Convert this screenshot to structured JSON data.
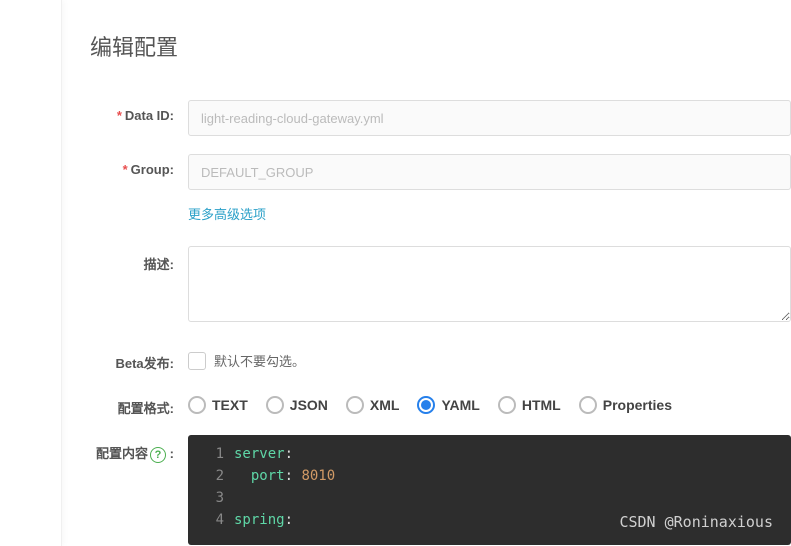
{
  "page_title": "编辑配置",
  "fields": {
    "data_id": {
      "label": "Data ID:",
      "value": "light-reading-cloud-gateway.yml"
    },
    "group": {
      "label": "Group:",
      "value": "DEFAULT_GROUP"
    },
    "more_link": "更多高级选项",
    "description": {
      "label": "描述:"
    },
    "beta": {
      "label": "Beta发布:",
      "hint": "默认不要勾选。"
    },
    "format": {
      "label": "配置格式:",
      "options": [
        "TEXT",
        "JSON",
        "XML",
        "YAML",
        "HTML",
        "Properties"
      ],
      "selected": "YAML"
    },
    "content": {
      "label": "配置内容"
    }
  },
  "code": {
    "lines": [
      {
        "n": 1,
        "key": "server",
        "colon": ":"
      },
      {
        "n": 2,
        "indent": "  ",
        "key": "port",
        "colon": ": ",
        "val": "8010"
      },
      {
        "n": 3
      },
      {
        "n": 4,
        "key": "spring",
        "colon": ":"
      }
    ]
  },
  "watermark": "CSDN @Roninaxious"
}
